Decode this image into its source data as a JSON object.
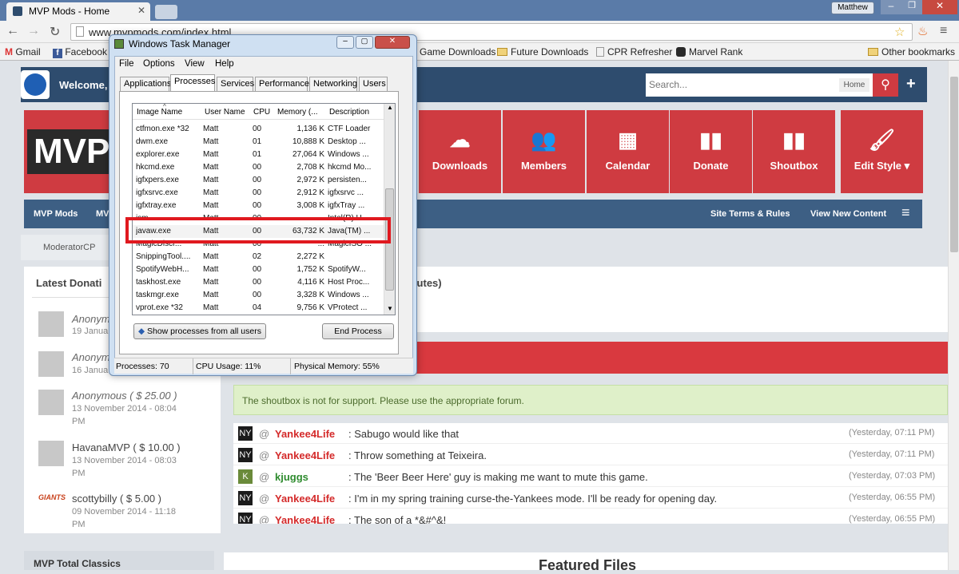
{
  "browser": {
    "tab_title": "MVP Mods - Home",
    "profile": "Matthew",
    "url": "www.mvpmods.com/index.html",
    "bookmarks": [
      "Gmail",
      "Facebook",
      "Game Downloads",
      "Future Downloads",
      "CPR Refresher",
      "Marvel Rank"
    ],
    "other_bookmarks": "Other bookmarks"
  },
  "site": {
    "welcome": "Welcome, r",
    "search_placeholder": "Search...",
    "search_scope": "Home",
    "logo": "MVP",
    "nav": [
      {
        "label": "Downloads",
        "icon": "cloud-download-icon"
      },
      {
        "label": "Members",
        "icon": "members-icon"
      },
      {
        "label": "Calendar",
        "icon": "calendar-icon"
      },
      {
        "label": "Donate",
        "icon": "donate-icon"
      },
      {
        "label": "Shoutbox",
        "icon": "shoutbox-icon"
      },
      {
        "label": "Edit Style",
        "icon": "brush-icon"
      }
    ],
    "subnav_left": "MVP Mods",
    "subnav_left2": "MV",
    "subnav_right": [
      "Site Terms & Rules",
      "View New Content"
    ],
    "moderator": "ModeratorCP",
    "latest_donations_title": "Latest Donati",
    "minutes_text": "inutes)",
    "donations": [
      {
        "name": "Anonym",
        "date": "19 Janua",
        "time": ""
      },
      {
        "name": "Anonym",
        "date": "16 Janua",
        "time": ""
      },
      {
        "name": "Anonymous ( $ 25.00 )",
        "date": "13 November 2014 - 08:04",
        "time": "PM"
      },
      {
        "name": "HavanaMVP ( $ 10.00 )",
        "date": "13 November 2014 - 08:03",
        "time": "PM"
      },
      {
        "name": "scottybilly ( $ 5.00 )",
        "date": "09 November 2014 - 11:18",
        "time": "PM"
      }
    ],
    "shout_notice": "The shoutbox is not for support. Please use the appropriate forum.",
    "shouts": [
      {
        "user": "Yankee4Life",
        "msg": "Sabugo would like that",
        "time": "(Yesterday, 07:11 PM)",
        "color": "#d42a2a"
      },
      {
        "user": "Yankee4Life",
        "msg": "Throw something at Teixeira.",
        "time": "(Yesterday, 07:11 PM)",
        "color": "#d42a2a"
      },
      {
        "user": "kjuggs",
        "msg": "The 'Beer Beer Here' guy is making me want to mute this game.",
        "time": "(Yesterday, 07:03 PM)",
        "color": "#2e8b2e"
      },
      {
        "user": "Yankee4Life",
        "msg": "I'm in my spring training curse-the-Yankees mode. I'll be ready for opening day.",
        "time": "(Yesterday, 06:55 PM)",
        "color": "#d42a2a"
      },
      {
        "user": "Yankee4Life",
        "msg": "The son of a *&#^&!",
        "time": "(Yesterday, 06:55 PM)",
        "color": "#d42a2a"
      }
    ],
    "classics_title": "MVP Total Classics",
    "featured_title": "Featured Files"
  },
  "taskmgr": {
    "title": "Windows Task Manager",
    "menu": [
      "File",
      "Options",
      "View",
      "Help"
    ],
    "tabs": [
      "Applications",
      "Processes",
      "Services",
      "Performance",
      "Networking",
      "Users"
    ],
    "columns": [
      "Image Name",
      "User Name",
      "CPU",
      "Memory (...",
      "Description"
    ],
    "rows": [
      [
        "ctfmon.exe *32",
        "Matt",
        "00",
        "1,136 K",
        "CTF Loader"
      ],
      [
        "dwm.exe",
        "Matt",
        "01",
        "10,888 K",
        "Desktop ..."
      ],
      [
        "explorer.exe",
        "Matt",
        "01",
        "27,064 K",
        "Windows ..."
      ],
      [
        "hkcmd.exe",
        "Matt",
        "00",
        "2,708 K",
        "hkcmd Mo..."
      ],
      [
        "igfxpers.exe",
        "Matt",
        "00",
        "2,972 K",
        "persisten..."
      ],
      [
        "igfxsrvc.exe",
        "Matt",
        "00",
        "2,912 K",
        "igfxsrvc ..."
      ],
      [
        "igfxtray.exe",
        "Matt",
        "00",
        "3,008 K",
        "igfxTray ..."
      ],
      [
        "ism...",
        "Matt",
        "00",
        "...",
        "Intel(R) U..."
      ],
      [
        "javaw.exe",
        "Matt",
        "00",
        "63,732 K",
        "Java(TM) ..."
      ],
      [
        "MagicDiscr...",
        "Matt",
        "00",
        "...",
        "MagicISO ..."
      ],
      [
        "SnippingTool....",
        "Matt",
        "02",
        "2,272 K",
        ""
      ],
      [
        "SpotifyWebH...",
        "Matt",
        "00",
        "1,752 K",
        "SpotifyW..."
      ],
      [
        "taskhost.exe",
        "Matt",
        "00",
        "4,116 K",
        "Host Proc..."
      ],
      [
        "taskmgr.exe",
        "Matt",
        "00",
        "3,328 K",
        "Windows ..."
      ],
      [
        "vprot.exe *32",
        "Matt",
        "04",
        "9,756 K",
        "VProtect ..."
      ]
    ],
    "show_all": "Show processes from all users",
    "end_process": "End Process",
    "status": [
      "Processes: 70",
      "CPU Usage: 11%",
      "Physical Memory: 55%"
    ]
  }
}
